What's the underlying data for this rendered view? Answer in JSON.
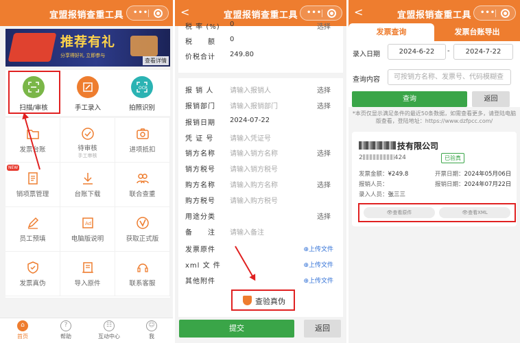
{
  "panel1": {
    "title": "宜盟报销查重工具",
    "banner": {
      "headline": "推荐有礼",
      "subtext": "分享得好礼 立即参与",
      "detail": "查看详情"
    },
    "main_actions": [
      {
        "label": "扫描/审核",
        "icon": "scan-icon",
        "color": "#7ab648"
      },
      {
        "label": "手工录入",
        "icon": "edit-icon",
        "color": "#ee7d2f"
      },
      {
        "label": "拍照识别",
        "icon": "ocr-icon",
        "color": "#2bb3b3"
      }
    ],
    "grid": [
      {
        "label": "发票台账",
        "sub": "",
        "icon": "folder-icon"
      },
      {
        "label": "待审核",
        "sub": "手工审核",
        "icon": "check-circle-icon"
      },
      {
        "label": "进项抵扣",
        "sub": "",
        "icon": "camera-icon"
      },
      {
        "label": "销项票管理",
        "sub": "",
        "icon": "doc-icon"
      },
      {
        "label": "台账下载",
        "sub": "",
        "icon": "download-icon"
      },
      {
        "label": "联合查重",
        "sub": "",
        "icon": "people-icon"
      },
      {
        "label": "员工预填",
        "sub": "",
        "icon": "pen-icon"
      },
      {
        "label": "电脑版说明",
        "sub": "",
        "icon": "desktop-icon"
      },
      {
        "label": "获取正式版",
        "sub": "",
        "icon": "v-icon"
      },
      {
        "label": "发票真伪",
        "sub": "",
        "icon": "shield-icon"
      },
      {
        "label": "导入原件",
        "sub": "",
        "icon": "import-icon"
      },
      {
        "label": "联系客服",
        "sub": "",
        "icon": "service-icon"
      }
    ],
    "new_badge": "NEW",
    "tabbar": [
      {
        "label": "首页",
        "glyph": "⌂"
      },
      {
        "label": "帮助",
        "glyph": "?"
      },
      {
        "label": "互动中心",
        "glyph": "☷"
      },
      {
        "label": "我",
        "glyph": "☺"
      }
    ]
  },
  "panel2": {
    "title": "宜盟报销查重工具",
    "rows_top": [
      {
        "key": "税 率 (%)",
        "value": "0",
        "action": "选择"
      },
      {
        "key": "税　　额",
        "value": "0",
        "action": ""
      },
      {
        "key": "价税合计",
        "value": "249.80",
        "action": ""
      }
    ],
    "rows_form": [
      {
        "key": "报 销 人",
        "value": "请输入报销人",
        "placeholder": true,
        "action": "选择"
      },
      {
        "key": "报销部门",
        "value": "请输入报销部门",
        "placeholder": true,
        "action": "选择"
      },
      {
        "key": "报销日期",
        "value": "2024-07-22",
        "placeholder": false,
        "action": ""
      },
      {
        "key": "凭 证 号",
        "value": "请输入凭证号",
        "placeholder": true,
        "action": ""
      },
      {
        "key": "销方名称",
        "value": "请输入销方名称",
        "placeholder": true,
        "action": "选择"
      },
      {
        "key": "销方税号",
        "value": "请输入销方税号",
        "placeholder": true,
        "action": ""
      },
      {
        "key": "购方名称",
        "value": "请输入购方名称",
        "placeholder": true,
        "action": "选择"
      },
      {
        "key": "购方税号",
        "value": "请输入购方税号",
        "placeholder": true,
        "action": ""
      },
      {
        "key": "用途分类",
        "value": "",
        "placeholder": false,
        "action": "选择"
      },
      {
        "key": "备　　注",
        "value": "请输入备注",
        "placeholder": true,
        "action": ""
      }
    ],
    "uploads": [
      {
        "key": "发票原件",
        "action": "⊕上传文件"
      },
      {
        "key": "xml 文 件",
        "action": "⊕上传文件"
      },
      {
        "key": "其他附件",
        "action": "⊕上传文件"
      }
    ],
    "verify_label": "查验真伪",
    "submit_label": "提交",
    "back_label": "返回"
  },
  "panel3": {
    "title": "宜盟报销查重工具",
    "tabs": [
      "发票查询",
      "发票台账导出"
    ],
    "entry_date_label": "录入日期",
    "date_from": "2024-6-22",
    "date_sep": "-",
    "date_to": "2024-7-22",
    "query_label": "查询内容",
    "query_placeholder": "可按销方名称、发票号、代码模糊查",
    "query_btn": "查询",
    "back_btn": "返回",
    "note": "*本页仅显示满足条件的最近50条数据，如需查看更多，请登陆电脑版查看，登陆地址：https://www.dzfpcc.com/",
    "card": {
      "company_suffix": "技有限公司",
      "invoice_prefix": "2",
      "invoice_suffix": "424",
      "status": "已验真",
      "amount_label": "发票金额：",
      "amount": "¥249.8",
      "issue_label": "开票日期：",
      "issue_date": "2024年05月06日",
      "reimb_label": "报销人员：",
      "reimb_value": "",
      "entry_date_label": "报销日期：",
      "entry_date": "2024年07月22日",
      "entry_person_label": "录入人员：",
      "entry_person": "张三三",
      "view_original": "👁查看原件",
      "view_xml": "👁查看XML"
    }
  }
}
